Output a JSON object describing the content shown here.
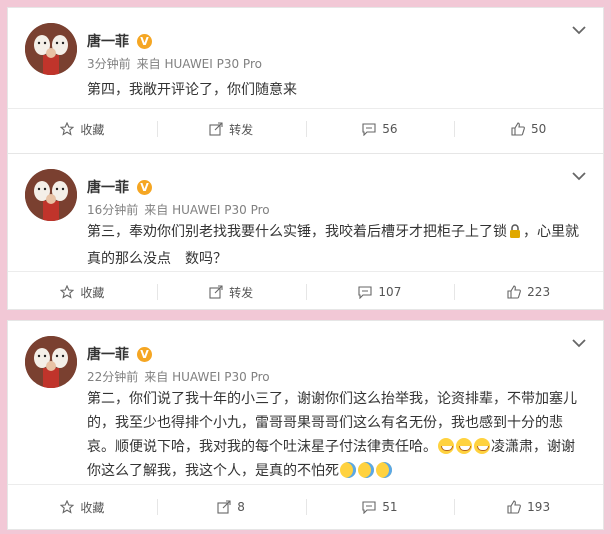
{
  "posts": [
    {
      "user": {
        "name": "唐一菲",
        "badge": "V"
      },
      "time": "3分钟前",
      "source": "来自 HUAWEI P30 Pro",
      "text": "第四，我敞开评论了，你们随意来",
      "actions": {
        "collect": "收藏",
        "repost": "转发",
        "comments": "56",
        "likes": "50"
      }
    },
    {
      "user": {
        "name": "唐一菲",
        "badge": "V"
      },
      "time": "16分钟前",
      "source": "来自 HUAWEI P30 Pro",
      "text_line1": "第三，奉劝你们别老找我要什么实锤，我咬着后槽牙才把柜子上了锁",
      "text_line1_after": "，心里就",
      "text_line2": "真的那么没点　数吗？",
      "actions": {
        "collect": "收藏",
        "repost": "转发",
        "comments": "107",
        "likes": "223"
      }
    },
    {
      "user": {
        "name": "唐一菲",
        "badge": "V"
      },
      "time": "22分钟前",
      "source": "来自 HUAWEI P30 Pro",
      "text_line1": "第二，你们说了我十年的小三了，谢谢你们这么抬举我，论资排辈，不带加塞儿",
      "text_line2": "的，我至少也得排个小九，雷哥哥果哥哥们这么有名无份，我也感到十分的悲",
      "text_line3": "哀。顺便说下哈，我对我的每个吐沫星子付法律责任哈。",
      "text_line3_after": "凌潇肃，谢谢",
      "text_line4": "你这么了解我，我这个人，是真的不怕死",
      "actions": {
        "collect": "收藏",
        "repost": "8",
        "comments": "51",
        "likes": "193"
      }
    }
  ],
  "colors": {
    "background": "#f2c8d6",
    "badge": "#f5a623",
    "meta": "#808080"
  }
}
